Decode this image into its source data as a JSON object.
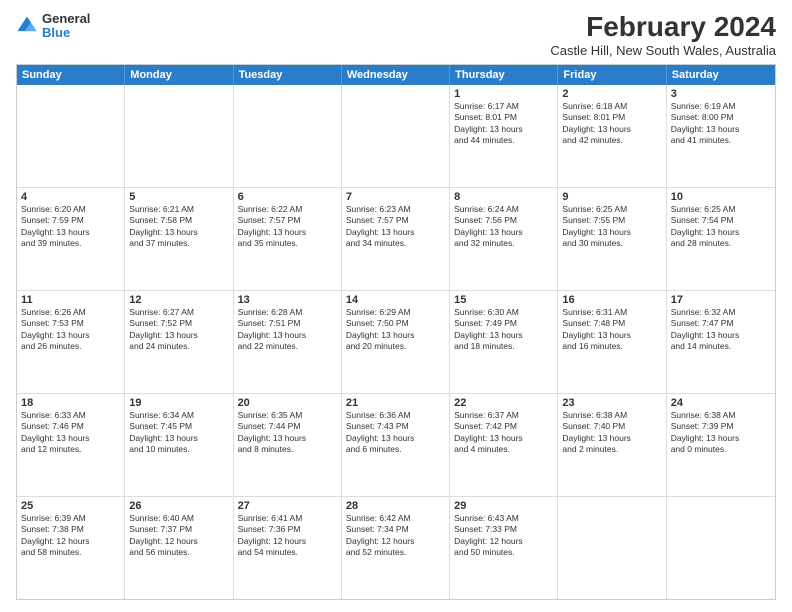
{
  "logo": {
    "general": "General",
    "blue": "Blue"
  },
  "title": "February 2024",
  "subtitle": "Castle Hill, New South Wales, Australia",
  "headers": [
    "Sunday",
    "Monday",
    "Tuesday",
    "Wednesday",
    "Thursday",
    "Friday",
    "Saturday"
  ],
  "rows": [
    [
      {
        "day": "",
        "info": ""
      },
      {
        "day": "",
        "info": ""
      },
      {
        "day": "",
        "info": ""
      },
      {
        "day": "",
        "info": ""
      },
      {
        "day": "1",
        "info": "Sunrise: 6:17 AM\nSunset: 8:01 PM\nDaylight: 13 hours\nand 44 minutes."
      },
      {
        "day": "2",
        "info": "Sunrise: 6:18 AM\nSunset: 8:01 PM\nDaylight: 13 hours\nand 42 minutes."
      },
      {
        "day": "3",
        "info": "Sunrise: 6:19 AM\nSunset: 8:00 PM\nDaylight: 13 hours\nand 41 minutes."
      }
    ],
    [
      {
        "day": "4",
        "info": "Sunrise: 6:20 AM\nSunset: 7:59 PM\nDaylight: 13 hours\nand 39 minutes."
      },
      {
        "day": "5",
        "info": "Sunrise: 6:21 AM\nSunset: 7:58 PM\nDaylight: 13 hours\nand 37 minutes."
      },
      {
        "day": "6",
        "info": "Sunrise: 6:22 AM\nSunset: 7:57 PM\nDaylight: 13 hours\nand 35 minutes."
      },
      {
        "day": "7",
        "info": "Sunrise: 6:23 AM\nSunset: 7:57 PM\nDaylight: 13 hours\nand 34 minutes."
      },
      {
        "day": "8",
        "info": "Sunrise: 6:24 AM\nSunset: 7:56 PM\nDaylight: 13 hours\nand 32 minutes."
      },
      {
        "day": "9",
        "info": "Sunrise: 6:25 AM\nSunset: 7:55 PM\nDaylight: 13 hours\nand 30 minutes."
      },
      {
        "day": "10",
        "info": "Sunrise: 6:25 AM\nSunset: 7:54 PM\nDaylight: 13 hours\nand 28 minutes."
      }
    ],
    [
      {
        "day": "11",
        "info": "Sunrise: 6:26 AM\nSunset: 7:53 PM\nDaylight: 13 hours\nand 26 minutes."
      },
      {
        "day": "12",
        "info": "Sunrise: 6:27 AM\nSunset: 7:52 PM\nDaylight: 13 hours\nand 24 minutes."
      },
      {
        "day": "13",
        "info": "Sunrise: 6:28 AM\nSunset: 7:51 PM\nDaylight: 13 hours\nand 22 minutes."
      },
      {
        "day": "14",
        "info": "Sunrise: 6:29 AM\nSunset: 7:50 PM\nDaylight: 13 hours\nand 20 minutes."
      },
      {
        "day": "15",
        "info": "Sunrise: 6:30 AM\nSunset: 7:49 PM\nDaylight: 13 hours\nand 18 minutes."
      },
      {
        "day": "16",
        "info": "Sunrise: 6:31 AM\nSunset: 7:48 PM\nDaylight: 13 hours\nand 16 minutes."
      },
      {
        "day": "17",
        "info": "Sunrise: 6:32 AM\nSunset: 7:47 PM\nDaylight: 13 hours\nand 14 minutes."
      }
    ],
    [
      {
        "day": "18",
        "info": "Sunrise: 6:33 AM\nSunset: 7:46 PM\nDaylight: 13 hours\nand 12 minutes."
      },
      {
        "day": "19",
        "info": "Sunrise: 6:34 AM\nSunset: 7:45 PM\nDaylight: 13 hours\nand 10 minutes."
      },
      {
        "day": "20",
        "info": "Sunrise: 6:35 AM\nSunset: 7:44 PM\nDaylight: 13 hours\nand 8 minutes."
      },
      {
        "day": "21",
        "info": "Sunrise: 6:36 AM\nSunset: 7:43 PM\nDaylight: 13 hours\nand 6 minutes."
      },
      {
        "day": "22",
        "info": "Sunrise: 6:37 AM\nSunset: 7:42 PM\nDaylight: 13 hours\nand 4 minutes."
      },
      {
        "day": "23",
        "info": "Sunrise: 6:38 AM\nSunset: 7:40 PM\nDaylight: 13 hours\nand 2 minutes."
      },
      {
        "day": "24",
        "info": "Sunrise: 6:38 AM\nSunset: 7:39 PM\nDaylight: 13 hours\nand 0 minutes."
      }
    ],
    [
      {
        "day": "25",
        "info": "Sunrise: 6:39 AM\nSunset: 7:38 PM\nDaylight: 12 hours\nand 58 minutes."
      },
      {
        "day": "26",
        "info": "Sunrise: 6:40 AM\nSunset: 7:37 PM\nDaylight: 12 hours\nand 56 minutes."
      },
      {
        "day": "27",
        "info": "Sunrise: 6:41 AM\nSunset: 7:36 PM\nDaylight: 12 hours\nand 54 minutes."
      },
      {
        "day": "28",
        "info": "Sunrise: 6:42 AM\nSunset: 7:34 PM\nDaylight: 12 hours\nand 52 minutes."
      },
      {
        "day": "29",
        "info": "Sunrise: 6:43 AM\nSunset: 7:33 PM\nDaylight: 12 hours\nand 50 minutes."
      },
      {
        "day": "",
        "info": ""
      },
      {
        "day": "",
        "info": ""
      }
    ]
  ]
}
